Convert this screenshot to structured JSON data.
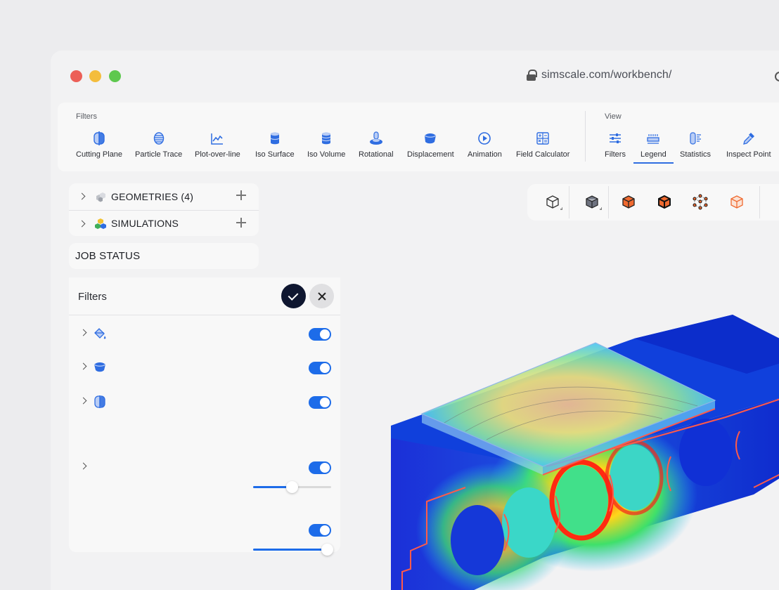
{
  "browser": {
    "url": "simscale.com/workbench/"
  },
  "toolbar": {
    "filters_label": "Filters",
    "view_label": "View",
    "filters": [
      {
        "label": "Cutting Plane",
        "icon": "cutting-plane-icon"
      },
      {
        "label": "Particle Trace",
        "icon": "particle-trace-icon"
      },
      {
        "label": "Plot-over-line",
        "icon": "plot-over-line-icon"
      },
      {
        "label": "Iso Surface",
        "icon": "iso-surface-icon"
      },
      {
        "label": "Iso Volume",
        "icon": "iso-volume-icon"
      },
      {
        "label": "Rotational",
        "icon": "rotational-icon"
      },
      {
        "label": "Displacement",
        "icon": "displacement-icon"
      },
      {
        "label": "Animation",
        "icon": "animation-icon"
      },
      {
        "label": "Field Calculator",
        "icon": "field-calculator-icon"
      }
    ],
    "view": [
      {
        "label": "Filters",
        "icon": "sliders-icon"
      },
      {
        "label": "Legend",
        "icon": "legend-icon",
        "active": true
      },
      {
        "label": "Statistics",
        "icon": "statistics-icon"
      },
      {
        "label": "Inspect Point",
        "icon": "pipette-icon"
      }
    ]
  },
  "tree": {
    "geometries_label": "GEOMETRIES",
    "geometries_count": "(4)",
    "simulations_label": "SIMULATIONS"
  },
  "job_status": "JOB STATUS",
  "filters_panel": {
    "title": "Filters",
    "rows": [
      {
        "icon": "paint-bucket-icon",
        "enabled": true
      },
      {
        "icon": "displacement-icon",
        "enabled": true
      },
      {
        "icon": "cutting-plane-icon",
        "enabled": true
      },
      {
        "slider": 0.5
      },
      {
        "icon": "",
        "enabled": true
      },
      {
        "slider": 1.0
      },
      {
        "enabled": true
      }
    ]
  },
  "view_buttons": [
    "cube-outline-icon",
    "cube-solid-icon",
    "cube-faces-icon",
    "cube-edges-icon",
    "cube-vertices-icon",
    "cube-wireframe-icon"
  ],
  "colors": {
    "accent": "#1d6ce9",
    "icon_blue": "#2f6de1",
    "highlight": "#ff5a3c",
    "confirm": "#0f1730"
  }
}
